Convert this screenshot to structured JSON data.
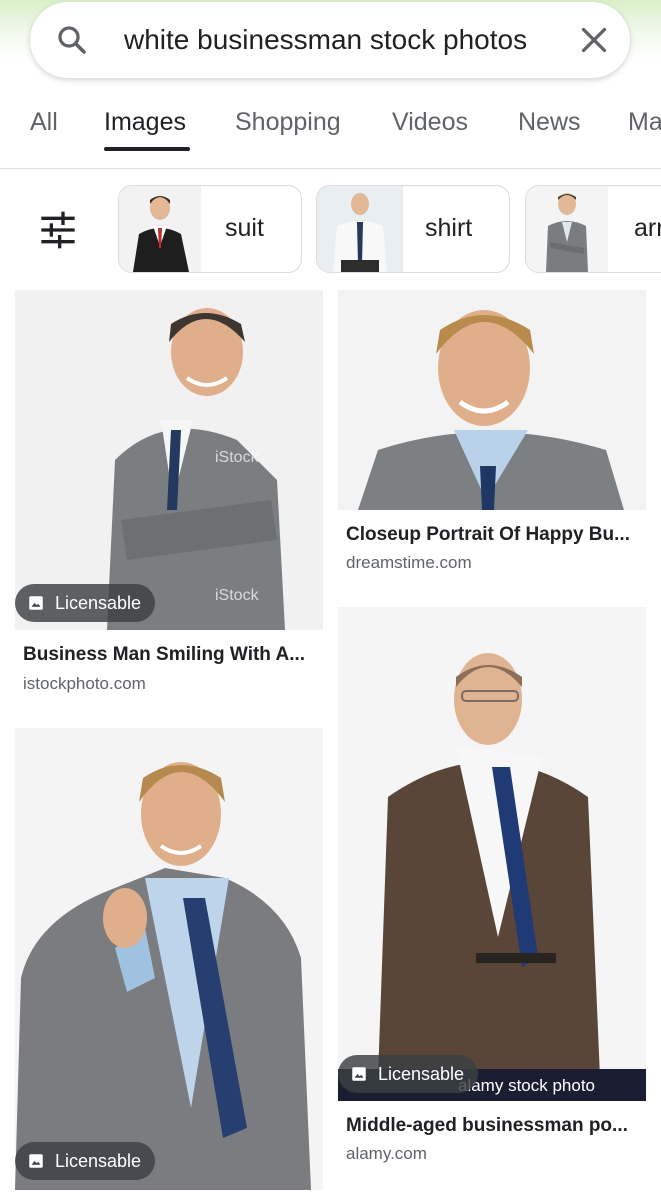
{
  "search": {
    "query": "white businessman stock photos"
  },
  "tabs": [
    {
      "label": "All"
    },
    {
      "label": "Images"
    },
    {
      "label": "Shopping"
    },
    {
      "label": "Videos"
    },
    {
      "label": "News"
    },
    {
      "label": "Ma"
    }
  ],
  "chips": [
    {
      "label": "suit",
      "icon": "man-in-suit-thumbnail"
    },
    {
      "label": "shirt",
      "icon": "man-in-shirt-thumbnail"
    },
    {
      "label": "arr",
      "icon": "man-arms-crossed-thumbnail"
    }
  ],
  "results": [
    {
      "title": "Business Man Smiling With A...",
      "source": "istockphoto.com",
      "badge": "Licensable"
    },
    {
      "title": "Closeup Portrait Of Happy Bu...",
      "source": "dreamstime.com"
    },
    {
      "title": "Middle-aged businessman po...",
      "source": "alamy.com",
      "badge": "Licensable"
    },
    {
      "title": "",
      "source": "",
      "badge": "Licensable"
    }
  ],
  "watermarks": {
    "istock": "iStock",
    "alamy": "alamy stock photo"
  },
  "colors": {
    "accent": "#202124",
    "top_gradient": "#d9f0c8",
    "suit_gray": "#7a7d80",
    "tie_blue": "#243a66"
  }
}
